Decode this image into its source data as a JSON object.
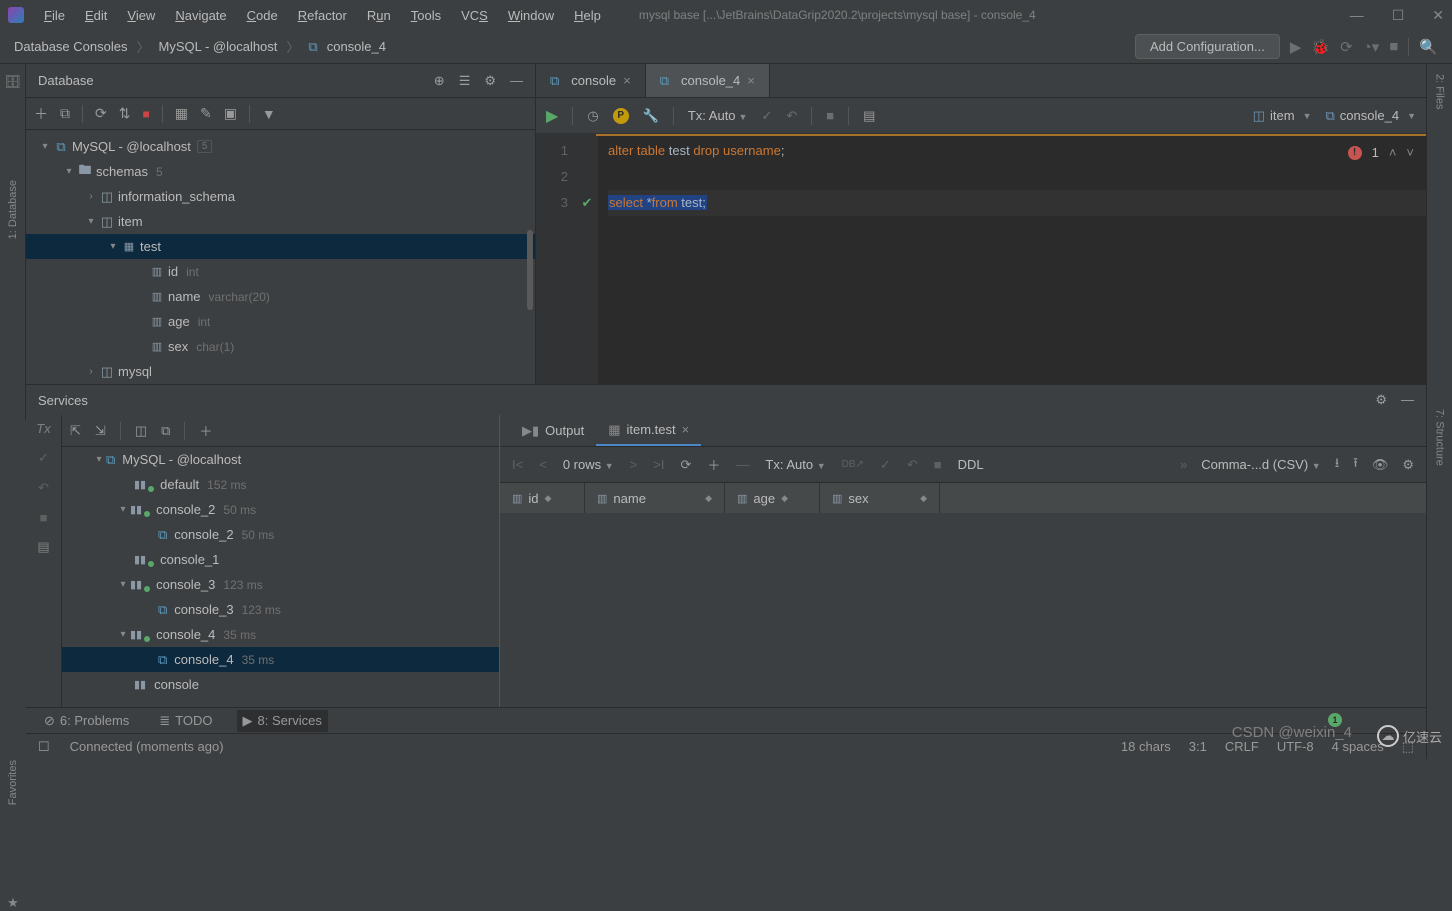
{
  "title": "mysql base [...\\JetBrains\\DataGrip2020.2\\projects\\mysql base] - console_4",
  "menu": [
    "File",
    "Edit",
    "View",
    "Navigate",
    "Code",
    "Refactor",
    "Run",
    "Tools",
    "VCS",
    "Window",
    "Help"
  ],
  "breadcrumbs": [
    "Database Consoles",
    "MySQL - @localhost",
    "console_4"
  ],
  "add_config": "Add Configuration...",
  "db_panel": {
    "title": "Database",
    "tree": {
      "root": "MySQL - @localhost",
      "root_badge": "5",
      "schemas": "schemas",
      "schemas_count": "5",
      "info_schema": "information_schema",
      "item": "item",
      "table": "test",
      "cols": [
        {
          "n": "id",
          "t": "int"
        },
        {
          "n": "name",
          "t": "varchar(20)"
        },
        {
          "n": "age",
          "t": "int"
        },
        {
          "n": "sex",
          "t": "char(1)"
        }
      ],
      "mysql": "mysql"
    }
  },
  "editor": {
    "tabs": [
      {
        "n": "console"
      },
      {
        "n": "console_4",
        "active": true
      }
    ],
    "tx": "Tx: Auto",
    "chip_item": "item",
    "chip_console": "console_4",
    "err_count": "1",
    "lines": [
      "1",
      "2",
      "3"
    ],
    "code1": {
      "a": "alter",
      "b": "table",
      "c": "test",
      "d": "drop",
      "e": "username",
      "f": ";"
    },
    "code3": {
      "a": "select",
      "b": "*",
      "c": "from",
      "d": "test",
      "e": ";"
    }
  },
  "services": {
    "title": "Services",
    "tree": {
      "root": "MySQL - @localhost",
      "default": "default",
      "default_t": "152 ms",
      "c2": "console_2",
      "c2_t": "50 ms",
      "c2s": "console_2",
      "c2s_t": "50 ms",
      "c1": "console_1",
      "c3": "console_3",
      "c3_t": "123 ms",
      "c3s": "console_3",
      "c3s_t": "123 ms",
      "c4": "console_4",
      "c4_t": "35 ms",
      "c4s": "console_4",
      "c4s_t": "35 ms",
      "cc": "console"
    },
    "result": {
      "tabs": [
        {
          "n": "Output"
        },
        {
          "n": "item.test",
          "active": true
        }
      ],
      "rows": "0 rows",
      "tx": "Tx: Auto",
      "ddl": "DDL",
      "csv": "Comma-...d (CSV)",
      "cols": [
        "id",
        "name",
        "age",
        "sex"
      ]
    }
  },
  "bottom_tabs": [
    {
      "i": "⊘",
      "n": "6: Problems"
    },
    {
      "i": "≣",
      "n": "TODO"
    },
    {
      "i": "▶",
      "n": "8: Services",
      "active": true
    }
  ],
  "status": {
    "conn": "Connected (moments ago)",
    "chars": "18 chars",
    "pos": "3:1",
    "crlf": "CRLF",
    "enc": "UTF-8",
    "sp": "4 spaces"
  },
  "rails": {
    "left_db": "1: Database",
    "left_fav": "Favorites",
    "right_files": "2: Files",
    "right_struct": "7: Structure"
  },
  "watermark": "CSDN @weixin_4",
  "watermark2": "亿速云"
}
